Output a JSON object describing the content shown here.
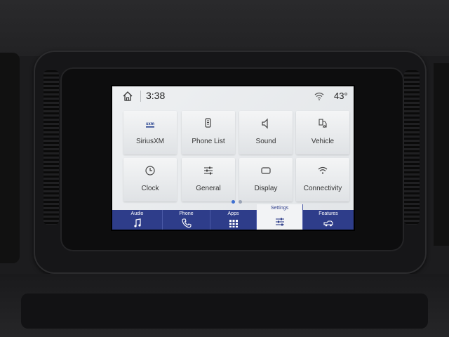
{
  "status": {
    "time": "3:38",
    "temperature": "43°"
  },
  "tiles": [
    {
      "label": "SiriusXM",
      "icon": "siriusxm-icon",
      "logo_text": "sxm"
    },
    {
      "label": "Phone List",
      "icon": "phone-list-icon"
    },
    {
      "label": "Sound",
      "icon": "speaker-icon"
    },
    {
      "label": "Vehicle",
      "icon": "vehicle-icon"
    },
    {
      "label": "Clock",
      "icon": "clock-icon"
    },
    {
      "label": "General",
      "icon": "sliders-icon"
    },
    {
      "label": "Display",
      "icon": "display-icon"
    },
    {
      "label": "Connectivity",
      "icon": "wifi-icon"
    }
  ],
  "pagination": {
    "pages": 2,
    "current": 1
  },
  "nav": [
    {
      "label": "Audio",
      "icon": "music-note-icon"
    },
    {
      "label": "Phone",
      "icon": "phone-icon"
    },
    {
      "label": "Apps",
      "icon": "apps-grid-icon"
    },
    {
      "label": "Settings",
      "icon": "settings-sliders-icon",
      "active": true
    },
    {
      "label": "Features",
      "icon": "truck-icon"
    }
  ],
  "colors": {
    "nav_bar": "#2e3d8a",
    "screen_bg": "#e8eaed",
    "active_tab_bg": "#f2f3f5",
    "dot_active": "#3d6fd1",
    "dot_inactive": "#9aa3b5"
  }
}
